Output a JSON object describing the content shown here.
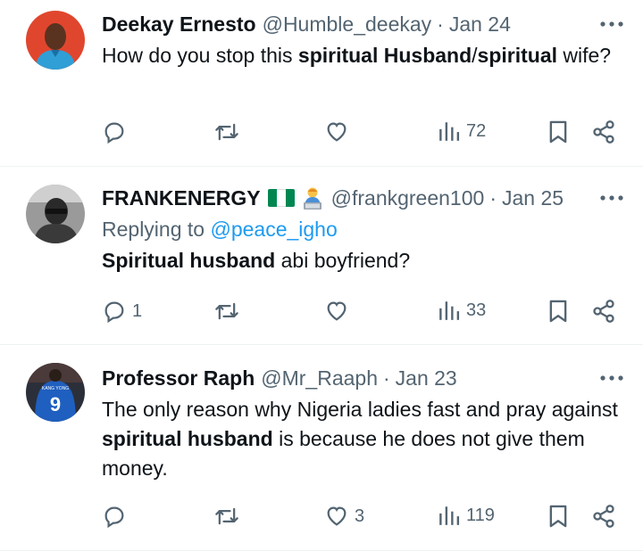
{
  "tweets": [
    {
      "name": "Deekay Ernesto",
      "handle": "@Humble_deekay",
      "dot": "·",
      "date": "Jan 24",
      "body_parts": [
        {
          "text": "How do you stop this ",
          "bold": false
        },
        {
          "text": "spiritual Husband",
          "bold": true
        },
        {
          "text": "/",
          "bold": false
        },
        {
          "text": "spiritual",
          "bold": true
        },
        {
          "text": " wife?",
          "bold": false
        }
      ],
      "actions": {
        "reply": "",
        "retweet": "",
        "like": "",
        "views": "72"
      }
    },
    {
      "name": "FRANKENERGY",
      "handle": "@frankgreen100",
      "dot": "·",
      "date": "Jan 25",
      "replying_label": "Replying to",
      "replying_to": "@peace_igho",
      "body_parts": [
        {
          "text": "Spiritual husband",
          "bold": true
        },
        {
          "text": " abi boyfriend?",
          "bold": false
        }
      ],
      "actions": {
        "reply": "1",
        "retweet": "",
        "like": "",
        "views": "33"
      }
    },
    {
      "name": "Professor Raph",
      "handle": "@Mr_Raaph",
      "dot": "·",
      "date": "Jan 23",
      "body_parts": [
        {
          "text": "The only reason why Nigeria ladies fast and pray against ",
          "bold": false
        },
        {
          "text": "spiritual husband",
          "bold": true
        },
        {
          "text": " is because he does not give them money.",
          "bold": false
        }
      ],
      "actions": {
        "reply": "",
        "retweet": "",
        "like": "3",
        "views": "119"
      }
    }
  ],
  "icons": {
    "more": "more-icon",
    "reply": "reply-icon",
    "retweet": "retweet-icon",
    "like": "heart-icon",
    "views": "views-icon",
    "bookmark": "bookmark-icon",
    "share": "share-icon",
    "flag": "nigeria-flag-icon",
    "emoji": "technologist-emoji-icon"
  },
  "colors": {
    "text": "#0f1419",
    "secondary": "#536471",
    "link": "#1d9bf0",
    "divider": "#eff3f4"
  },
  "avatar3_jersey": {
    "number": "9",
    "name": "KANG YONG"
  }
}
